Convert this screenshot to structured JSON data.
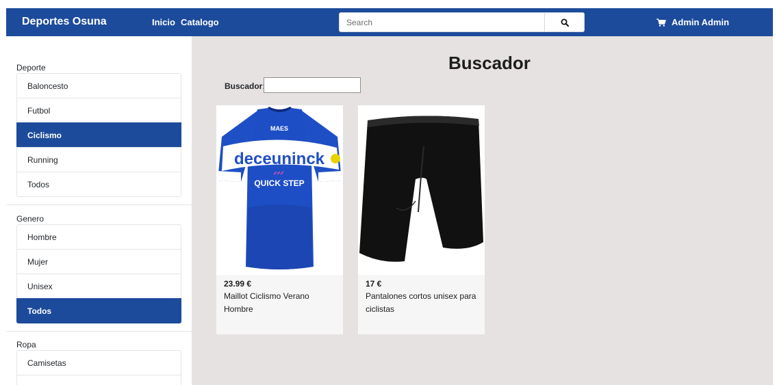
{
  "navbar": {
    "brand": "Deportes Osuna",
    "links": [
      "Inicio",
      "Catalogo"
    ],
    "search_placeholder": "Search",
    "user": "Admin Admin"
  },
  "sidebar": {
    "sections": [
      {
        "title": "Deporte",
        "items": [
          "Baloncesto",
          "Futbol",
          "Ciclismo",
          "Running",
          "Todos"
        ],
        "active": "Ciclismo"
      },
      {
        "title": "Genero",
        "items": [
          "Hombre",
          "Mujer",
          "Unisex",
          "Todos"
        ],
        "active": "Todos"
      },
      {
        "title": "Ropa",
        "items": [
          "Camisetas",
          ""
        ],
        "active": ""
      }
    ]
  },
  "main": {
    "title": "Buscador",
    "search_label": "Buscador:",
    "search_value": "",
    "products": [
      {
        "price": "23.99 €",
        "name": "Maillot Ciclismo Verano Hombre",
        "image": "blue-cycling-jersey"
      },
      {
        "price": "17 €",
        "name": "Pantalones cortos unisex para ciclistas",
        "image": "black-cycling-shorts"
      }
    ]
  },
  "colors": {
    "primary": "#1d4b9b",
    "main_bg": "#e6e2e2"
  }
}
